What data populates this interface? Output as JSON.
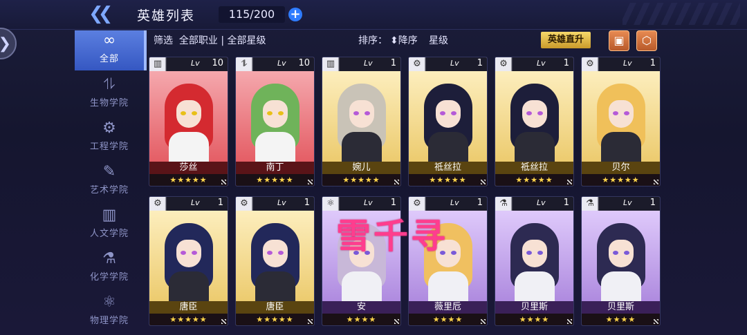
{
  "header": {
    "back_icon": "double-chevron-left-icon",
    "title": "英雄列表",
    "count": "115/200",
    "add_icon": "plus-icon"
  },
  "edge_toggle_icon": "chevron-right-icon",
  "sidebar": {
    "items": [
      {
        "label": "全部",
        "icon": "infinity-icon",
        "active": true
      },
      {
        "label": "生物学院",
        "icon": "dna-icon",
        "active": false
      },
      {
        "label": "工程学院",
        "icon": "robot-icon",
        "active": false
      },
      {
        "label": "艺术学院",
        "icon": "palette-icon",
        "active": false
      },
      {
        "label": "人文学院",
        "icon": "book-icon",
        "active": false
      },
      {
        "label": "化学学院",
        "icon": "flask-icon",
        "active": false
      },
      {
        "label": "物理学院",
        "icon": "atom-icon",
        "active": false
      }
    ]
  },
  "filter": {
    "text": "筛选  全部职业 | 全部星级",
    "sort_label": "排序：",
    "sort_order": "降序",
    "sort_field": "星级",
    "upgrade_label": "英雄直升",
    "team_icon": "id-card-icon",
    "settings_icon": "hexagon-icon"
  },
  "cards": [
    {
      "name": "莎丝",
      "level": "10",
      "lv_label": "Lv",
      "stars": "★★★★★",
      "class_icon": "book-icon",
      "theme": "red"
    },
    {
      "name": "南丁",
      "level": "10",
      "lv_label": "Lv",
      "stars": "★★★★★",
      "class_icon": "dna-icon",
      "theme": "red"
    },
    {
      "name": "婉儿",
      "level": "1",
      "lv_label": "Lv",
      "stars": "★★★★★",
      "class_icon": "book-icon",
      "theme": "gold"
    },
    {
      "name": "祗丝拉",
      "level": "1",
      "lv_label": "Lv",
      "stars": "★★★★★",
      "class_icon": "robot-icon",
      "theme": "gold"
    },
    {
      "name": "祗丝拉",
      "level": "1",
      "lv_label": "Lv",
      "stars": "★★★★★",
      "class_icon": "robot-icon",
      "theme": "gold"
    },
    {
      "name": "贝尔",
      "level": "1",
      "lv_label": "Lv",
      "stars": "★★★★★",
      "class_icon": "robot-icon",
      "theme": "gold"
    },
    {
      "name": "唐臣",
      "level": "1",
      "lv_label": "Lv",
      "stars": "★★★★★",
      "class_icon": "robot-icon",
      "theme": "gold"
    },
    {
      "name": "唐臣",
      "level": "1",
      "lv_label": "Lv",
      "stars": "★★★★★",
      "class_icon": "robot-icon",
      "theme": "gold"
    },
    {
      "name": "安",
      "level": "1",
      "lv_label": "Lv",
      "stars": "★★★★",
      "class_icon": "atom-icon",
      "theme": "purple"
    },
    {
      "name": "薇里卮",
      "level": "1",
      "lv_label": "Lv",
      "stars": "★★★★",
      "class_icon": "robot-icon",
      "theme": "purple"
    },
    {
      "name": "贝里斯",
      "level": "1",
      "lv_label": "Lv",
      "stars": "★★★★",
      "class_icon": "flask-icon",
      "theme": "purple"
    },
    {
      "name": "贝里斯",
      "level": "1",
      "lv_label": "Lv",
      "stars": "★★★★",
      "class_icon": "flask-icon",
      "theme": "purple"
    }
  ],
  "watermark": "雪千寻",
  "colors": {
    "red": "#e04a52",
    "gold": "#e8c25a",
    "purple": "#a27ad8",
    "accent": "#3f66d6"
  }
}
